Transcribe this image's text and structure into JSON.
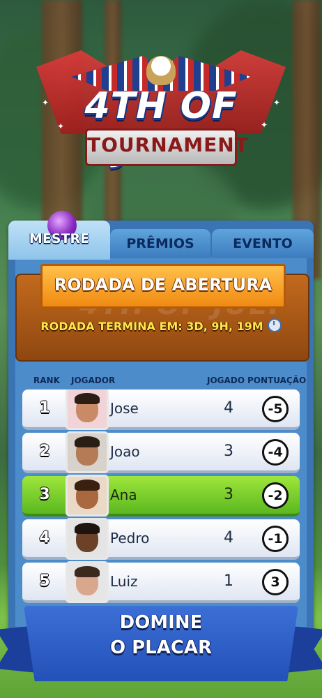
{
  "logo": {
    "title": "4TH OF JULY",
    "subtitle": "TOURNAMENT"
  },
  "tabs": [
    {
      "label": "MESTRE",
      "active": true
    },
    {
      "label": "PRÊMIOS",
      "active": false
    },
    {
      "label": "EVENTO",
      "active": false
    }
  ],
  "round": {
    "title": "RODADA DE ABERTURA",
    "watermark": "4TH OF JULY",
    "timer": "RODADA TERMINA EM: 3D, 9H, 19M"
  },
  "table": {
    "headers": {
      "rank": "RANK",
      "player": "JOGADOR",
      "played": "JOGADO",
      "score": "PONTUAÇÃO"
    },
    "rows": [
      {
        "rank": "1",
        "name": "Jose",
        "played": "4",
        "score": "-5",
        "highlight": false
      },
      {
        "rank": "2",
        "name": "Joao",
        "played": "3",
        "score": "-4",
        "highlight": false
      },
      {
        "rank": "3",
        "name": "Ana",
        "played": "3",
        "score": "-2",
        "highlight": true
      },
      {
        "rank": "4",
        "name": "Pedro",
        "played": "4",
        "score": "-1",
        "highlight": false
      },
      {
        "rank": "5",
        "name": "Luiz",
        "played": "1",
        "score": "3",
        "highlight": false
      }
    ]
  },
  "banner": {
    "line1": "DOMINE",
    "line2": "O PLACAR"
  },
  "colors": {
    "panel": "#3b74b4",
    "highlight_row": "#7ed12e",
    "round_orange": "#f08a12",
    "ribbon_blue": "#2351b8"
  }
}
